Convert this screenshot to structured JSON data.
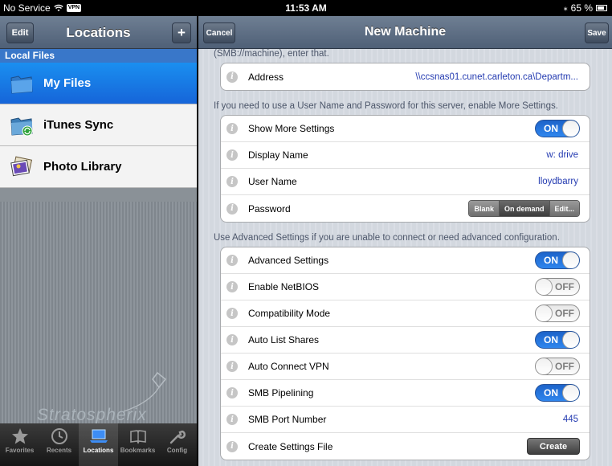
{
  "status_bar": {
    "carrier": "No Service",
    "vpn": "VPN",
    "time": "11:53 AM",
    "battery": "65 %"
  },
  "left_panel": {
    "nav": {
      "edit_label": "Edit",
      "title": "Locations",
      "add_label": "+"
    },
    "section_header": "Local Files",
    "items": [
      {
        "label": "My Files",
        "icon": "folder-icon",
        "selected": true
      },
      {
        "label": "iTunes Sync",
        "icon": "itunes-sync-icon",
        "selected": false
      },
      {
        "label": "Photo Library",
        "icon": "photo-library-icon",
        "selected": false
      }
    ],
    "brand": "Stratospherix",
    "tabs": [
      {
        "label": "Favorites",
        "icon": "star-icon",
        "active": false
      },
      {
        "label": "Recents",
        "icon": "clock-icon",
        "active": false
      },
      {
        "label": "Locations",
        "icon": "laptop-icon",
        "active": true
      },
      {
        "label": "Bookmarks",
        "icon": "book-icon",
        "active": false
      },
      {
        "label": "Config",
        "icon": "wrench-icon",
        "active": false
      }
    ]
  },
  "right_panel": {
    "nav": {
      "cancel_label": "Cancel",
      "title": "New Machine",
      "save_label": "Save"
    },
    "caption_top": "(SMB://machine), enter that.",
    "address": {
      "label": "Address",
      "value": "\\\\ccsnas01.cunet.carleton.ca\\Departm..."
    },
    "caption_credentials": "If you need to use a User Name and Password for this server, enable More Settings.",
    "more_settings": {
      "show_more": {
        "label": "Show More Settings",
        "toggle": "ON"
      },
      "display_name": {
        "label": "Display Name",
        "value": "w: drive"
      },
      "user_name": {
        "label": "User Name",
        "value": "lloydbarry"
      },
      "password": {
        "label": "Password",
        "options": [
          "Blank",
          "On demand",
          "Edit..."
        ]
      }
    },
    "caption_advanced": "Use Advanced Settings if you are unable to connect or need advanced configuration.",
    "advanced": {
      "advanced_settings": {
        "label": "Advanced Settings",
        "toggle": "ON"
      },
      "enable_netbios": {
        "label": "Enable NetBIOS",
        "toggle": "OFF"
      },
      "compatibility_mode": {
        "label": "Compatibility Mode",
        "toggle": "OFF"
      },
      "auto_list_shares": {
        "label": "Auto List Shares",
        "toggle": "ON"
      },
      "auto_connect_vpn": {
        "label": "Auto Connect VPN",
        "toggle": "OFF"
      },
      "smb_pipelining": {
        "label": "SMB Pipelining",
        "toggle": "ON"
      },
      "smb_port_number": {
        "label": "SMB Port Number",
        "value": "445"
      },
      "create_settings_file": {
        "label": "Create Settings File",
        "button": "Create"
      }
    },
    "info_glyph": "i"
  },
  "colors": {
    "accent_blue": "#1665d9",
    "value_blue": "#243bb1",
    "nav_bar": "#5b6b82"
  }
}
